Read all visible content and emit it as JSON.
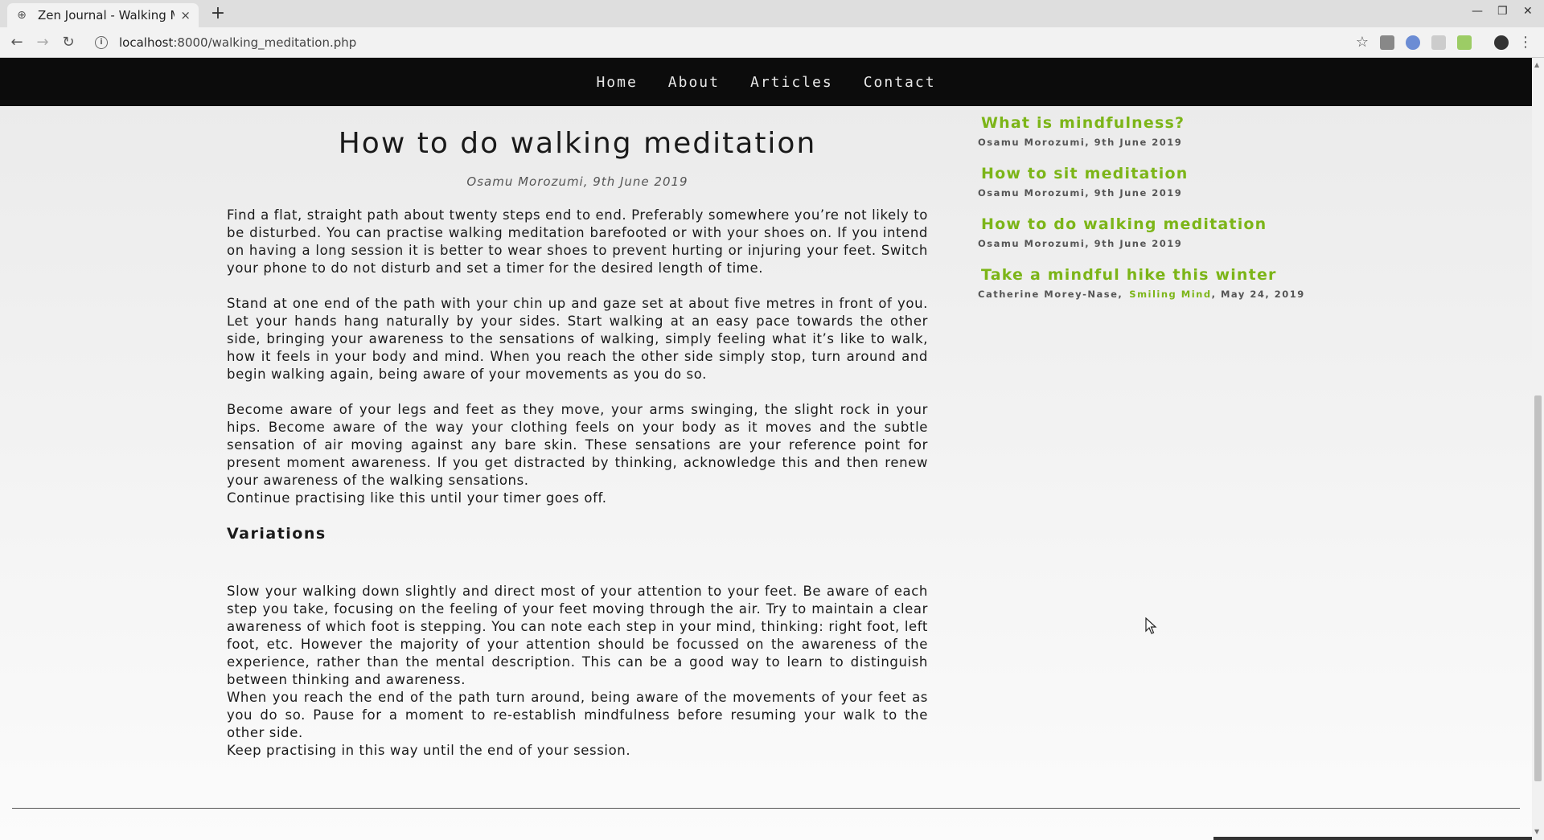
{
  "browser": {
    "tab_title": "Zen Journal - Walking Med",
    "tab_close": "×",
    "new_tab": "+",
    "url": "localhost:8000/walking_meditation.php",
    "url_host": "localhost",
    "url_rest": ":8000/walking_meditation.php",
    "win_min": "—",
    "win_max": "❐",
    "win_close": "✕",
    "back": "←",
    "forward": "→",
    "reload": "↻",
    "star": "☆",
    "menu": "⋮"
  },
  "nav": {
    "items": [
      "Home",
      "About",
      "Articles",
      "Contact"
    ]
  },
  "article": {
    "title": "How to do walking meditation",
    "meta": "Osamu Morozumi, 9th June 2019",
    "p1": "Find a flat, straight path about twenty steps end to end. Preferably somewhere you’re not likely to be disturbed. You can practise walking meditation barefooted or with your shoes on. If you intend on having a long session it is better to wear shoes to prevent hurting or injuring your feet. Switch your phone to do not disturb and set a timer for the desired length of time.",
    "p2": "Stand at one end of the path with your chin up and gaze set at about five metres in front of you. Let your hands hang naturally by your sides. Start walking at an easy pace towards the other side, bringing your awareness to the sensations of walking, simply feeling what it’s like to walk, how it feels in your body and mind. When you reach the other side simply stop, turn around and begin walking again, being aware of your movements as you do so.",
    "p3": "Become aware of your legs and feet as they move, your arms swinging, the slight rock in your hips. Become aware of the way your clothing feels on your body as it moves and the subtle sensation of air moving against any bare skin. These sensations are your reference point for present moment awareness. If you get distracted by thinking, acknowledge this and then renew your awareness of the walking sensations.",
    "p4": "Continue practising like this until your timer goes off.",
    "variations_heading": "Variations",
    "p5": "Slow your walking down slightly and direct most of your attention to your feet. Be aware of each step you take, focusing on the feeling of your feet moving through the air. Try to maintain a clear awareness of which foot is stepping. You can note each step in your mind, thinking: right foot, left foot, etc. However the majority of your attention should be focussed on the awareness of the experience, rather than the mental description. This can be a good way to learn to distinguish between thinking and awareness.",
    "p6": "When you reach the end of the path turn around, being aware of the movements of your feet as you do so. Pause for a moment to re-establish mindfulness before resuming your walk to the other side.",
    "p7": "Keep practising in this way until the end of your session."
  },
  "sidebar": {
    "items": [
      {
        "title": "What is mindfulness?",
        "meta": "Osamu Morozumi, 9th June 2019"
      },
      {
        "title": "How to sit meditation",
        "meta": "Osamu Morozumi, 9th June 2019"
      },
      {
        "title": "How to do walking meditation",
        "meta": "Osamu Morozumi, 9th June 2019"
      },
      {
        "title": "Take a mindful hike this winter",
        "meta_author": "Catherine Morey-Nase,",
        "meta_source": "Smiling Mind",
        "meta_date": ", May 24, 2019"
      }
    ]
  },
  "colors": {
    "accent_green": "#7cb518",
    "navbar_bg": "#0c0c0c"
  }
}
